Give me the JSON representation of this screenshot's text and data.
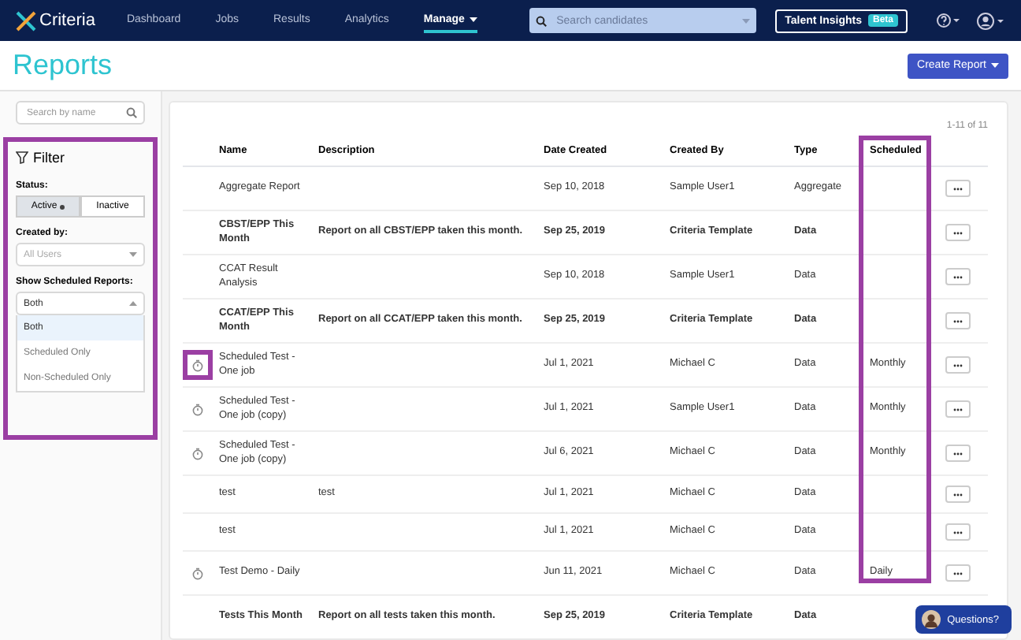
{
  "nav": {
    "logo": "Criteria",
    "links": [
      {
        "label": "Dashboard",
        "selected": false
      },
      {
        "label": "Jobs",
        "selected": false
      },
      {
        "label": "Results",
        "selected": false
      },
      {
        "label": "Analytics",
        "selected": false
      },
      {
        "label": "Manage",
        "selected": true
      }
    ],
    "search": {
      "placeholder": "Search candidates"
    },
    "insights": {
      "label": "Talent Insights",
      "badge": "Beta"
    }
  },
  "header": {
    "title": "Reports",
    "button": "Create Report"
  },
  "sidebar": {
    "search": {
      "placeholder": "Search by name"
    },
    "filter": {
      "title": "Filter",
      "highlighted": true,
      "status_label": "Status:",
      "status": [
        {
          "label": "Active",
          "selected": true
        },
        {
          "label": "Inactive",
          "selected": false
        }
      ],
      "created_label": "Created by:",
      "created": {
        "placeholder": "All Users"
      },
      "scheduled_label": "Show Scheduled Reports:",
      "scheduled": {
        "value": "Both",
        "expanded": true,
        "options": [
          {
            "label": "Both",
            "selected": true
          },
          {
            "label": "Scheduled Only",
            "selected": false
          },
          {
            "label": "Non-Scheduled Only",
            "selected": false
          }
        ]
      }
    }
  },
  "table": {
    "count": "1-11 of 11",
    "columns": [
      "Name",
      "Description",
      "Date Created",
      "Created By",
      "Type",
      "Scheduled"
    ],
    "scheduled_highlighted": true,
    "rows": [
      {
        "scheduled_icon": false,
        "icon_highlighted": false,
        "template": false,
        "cells": [
          "Aggregate Report",
          "",
          "Sep 10, 2018",
          "Sample User1",
          "Aggregate",
          ""
        ]
      },
      {
        "scheduled_icon": false,
        "icon_highlighted": false,
        "template": true,
        "cells": [
          "CBST/EPP This Month",
          "Report on all CBST/EPP taken this month.",
          "Sep 25, 2019",
          "Criteria Template",
          "Data",
          ""
        ]
      },
      {
        "scheduled_icon": false,
        "icon_highlighted": false,
        "template": false,
        "cells": [
          "CCAT Result Analysis",
          "",
          "Sep 10, 2018",
          "Sample User1",
          "Data",
          ""
        ]
      },
      {
        "scheduled_icon": false,
        "icon_highlighted": false,
        "template": true,
        "cells": [
          "CCAT/EPP This Month",
          "Report on all CCAT/EPP taken this month.",
          "Sep 25, 2019",
          "Criteria Template",
          "Data",
          ""
        ]
      },
      {
        "scheduled_icon": true,
        "icon_highlighted": true,
        "template": false,
        "cells": [
          "Scheduled Test - One job",
          "",
          "Jul 1, 2021",
          "Michael C",
          "Data",
          "Monthly"
        ]
      },
      {
        "scheduled_icon": true,
        "icon_highlighted": false,
        "template": false,
        "cells": [
          "Scheduled Test - One job (copy)",
          "",
          "Jul 1, 2021",
          "Sample User1",
          "Data",
          "Monthly"
        ]
      },
      {
        "scheduled_icon": true,
        "icon_highlighted": false,
        "template": false,
        "cells": [
          "Scheduled Test - One job (copy)",
          "",
          "Jul 6, 2021",
          "Michael C",
          "Data",
          "Monthly"
        ]
      },
      {
        "scheduled_icon": false,
        "icon_highlighted": false,
        "template": false,
        "cells": [
          "test",
          "test",
          "Jul 1, 2021",
          "Michael C",
          "Data",
          ""
        ]
      },
      {
        "scheduled_icon": false,
        "icon_highlighted": false,
        "template": false,
        "cells": [
          "test",
          "",
          "Jul 1, 2021",
          "Michael C",
          "Data",
          ""
        ]
      },
      {
        "scheduled_icon": true,
        "icon_highlighted": false,
        "template": false,
        "cells": [
          "Test Demo - Daily",
          "",
          "Jun 11, 2021",
          "Michael C",
          "Data",
          "Daily"
        ]
      },
      {
        "scheduled_icon": false,
        "icon_highlighted": false,
        "template": true,
        "cells": [
          "Tests This Month",
          "Report on all tests taken this month.",
          "Sep 25, 2019",
          "Criteria Template",
          "Data",
          ""
        ]
      }
    ]
  },
  "chat": {
    "label": "Questions?"
  }
}
